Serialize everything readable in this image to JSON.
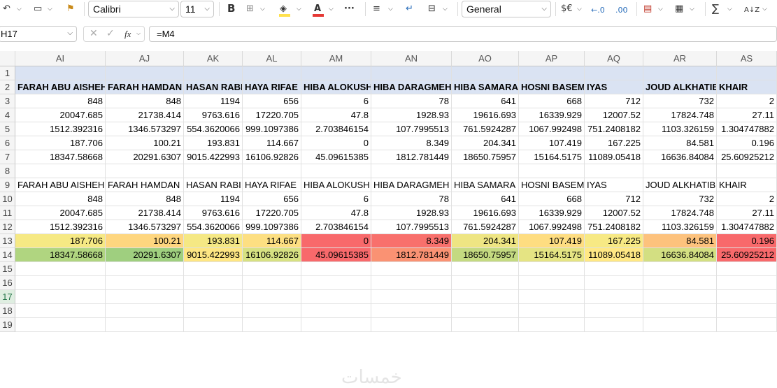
{
  "toolbar": {
    "font_name": "Calibri",
    "font_size": "11",
    "bold_label": "B",
    "number_format": "General",
    "undo_icon": "undo-icon",
    "clipboard_icon": "clipboard-icon",
    "format_painter_icon": "format-painter-icon",
    "borders_icon": "borders-icon",
    "fill_color": "#ffe14d",
    "font_color": "#e53935",
    "more_icon": "more-icon",
    "align_icon": "align-icon",
    "wrap_icon": "wrap-text-icon",
    "merge_icon": "merge-icon",
    "currency_label": "$€",
    "decrease_decimal_label": "←.0",
    "increase_decimal_label": ".00",
    "cond_format_icon": "conditional-format-icon",
    "format_table_icon": "format-as-table-icon",
    "sum_label": "∑",
    "sort_label": "A↓Z"
  },
  "formula_bar": {
    "name_box": "H17",
    "fx_label": "fx",
    "formula": "=M4"
  },
  "columns": [
    "AI",
    "AJ",
    "AK",
    "AL",
    "AM",
    "AN",
    "AO",
    "AP",
    "AQ",
    "AR",
    "AS"
  ],
  "rows": [
    "1",
    "2",
    "3",
    "4",
    "5",
    "6",
    "7",
    "8",
    "9",
    "10",
    "11",
    "12",
    "13",
    "14",
    "15",
    "16",
    "17",
    "18",
    "19"
  ],
  "selected_row": "17",
  "table1": {
    "headers": [
      "FARAH ABU AISHEH",
      "FARAH HAMDAN",
      "HASAN RABI",
      "HAYA RIFAE",
      "HIBA ALOKUSH",
      "HIBA DARAGMEH",
      "HIBA SAMARA",
      "HOSNI BASEM",
      "IYAS",
      "JOUD ALKHATIB",
      "KHAIR"
    ],
    "header_fill": "#dae3f3",
    "data": [
      [
        "848",
        "848",
        "1194",
        "656",
        "6",
        "78",
        "641",
        "668",
        "712",
        "732",
        "2"
      ],
      [
        "20047.685",
        "21738.414",
        "9763.616",
        "17220.705",
        "47.8",
        "1928.93",
        "19616.693",
        "16339.929",
        "12007.52",
        "17824.748",
        "27.11"
      ],
      [
        "1512.392316",
        "1346.573297",
        "554.3620066",
        "999.1097386",
        "2.703846154",
        "107.7995513",
        "761.5924287",
        "1067.992498",
        "751.2408182",
        "1103.326159",
        "1.304747882"
      ],
      [
        "187.706",
        "100.21",
        "193.831",
        "114.667",
        "0",
        "8.349",
        "204.341",
        "107.419",
        "167.225",
        "84.581",
        "0.196"
      ],
      [
        "18347.58668",
        "20291.6307",
        "9015.422993",
        "16106.92826",
        "45.09615385",
        "1812.781449",
        "18650.75957",
        "15164.5175",
        "11089.05418",
        "16636.84084",
        "25.60925212"
      ]
    ]
  },
  "table2": {
    "headers": [
      "FARAH ABU AISHEH",
      "FARAH HAMDAN",
      "HASAN RABI",
      "HAYA RIFAE",
      "HIBA ALOKUSH",
      "HIBA DARAGMEH",
      "HIBA SAMARA",
      "HOSNI BASEM",
      "IYAS",
      "JOUD ALKHATIB",
      "KHAIR"
    ],
    "data": [
      [
        "848",
        "848",
        "1194",
        "656",
        "6",
        "78",
        "641",
        "668",
        "712",
        "732",
        "2"
      ],
      [
        "20047.685",
        "21738.414",
        "9763.616",
        "17220.705",
        "47.8",
        "1928.93",
        "19616.693",
        "16339.929",
        "12007.52",
        "17824.748",
        "27.11"
      ],
      [
        "1512.392316",
        "1346.573297",
        "554.3620066",
        "999.1097386",
        "2.703846154",
        "107.7995513",
        "761.5924287",
        "1067.992498",
        "751.2408182",
        "1103.326159",
        "1.304747882"
      ],
      [
        "187.706",
        "100.21",
        "193.831",
        "114.667",
        "0",
        "8.349",
        "204.341",
        "107.419",
        "167.225",
        "84.581",
        "0.196"
      ],
      [
        "18347.58668",
        "20291.6307",
        "9015.422993",
        "16106.92826",
        "45.09615385",
        "1812.781449",
        "18650.75957",
        "15164.5175",
        "11089.05418",
        "16636.84084",
        "25.60925212"
      ]
    ],
    "row13_colors": [
      "#f6e984",
      "#fed67f",
      "#f5e884",
      "#fddf82",
      "#f8696b",
      "#f8706c",
      "#eee583",
      "#fedd81",
      "#f7e984",
      "#fdc27d",
      "#f8696b"
    ],
    "row14_colors": [
      "#b0d580",
      "#9fcf7f",
      "#fee683",
      "#d7e182",
      "#f8696b",
      "#fa9273",
      "#c4da81",
      "#e5e483",
      "#ffe884",
      "#d3df82",
      "#f8696b"
    ]
  },
  "watermark": "خمسات"
}
